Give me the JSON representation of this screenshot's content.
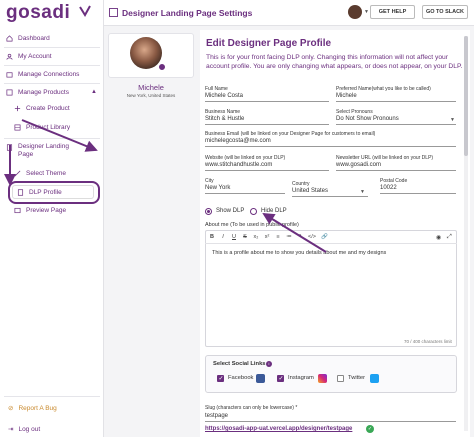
{
  "brand": {
    "logo_text": "gosadi",
    "accent": "#6b2f7f"
  },
  "sidebar": {
    "items": [
      {
        "label": "Dashboard",
        "icon": "home-icon"
      },
      {
        "label": "My Account",
        "icon": "user-icon"
      },
      {
        "label": "Manage Connections",
        "icon": "link-icon"
      },
      {
        "label": "Manage Products",
        "icon": "box-icon"
      },
      {
        "label": "Create Product",
        "icon": "plus-icon"
      },
      {
        "label": "Product Library",
        "icon": "library-icon"
      },
      {
        "label": "Designer Landing Page",
        "icon": "page-icon"
      },
      {
        "label": "Select Theme",
        "icon": "palette-icon"
      },
      {
        "label": "DLP Profile",
        "icon": "profile-icon"
      },
      {
        "label": "Preview Page",
        "icon": "eye-icon"
      }
    ],
    "report_bug": "Report A Bug",
    "logout": "Log out"
  },
  "header": {
    "title": "Designer Landing Page Settings",
    "get_help": "GET HELP",
    "go_to_slack": "GO TO SLACK"
  },
  "profile": {
    "name": "Michele",
    "location": "New York, United States"
  },
  "form": {
    "title": "Edit Designer Page Profile",
    "description": "This is for your front facing DLP only. Changing this information will not affect your account profile. You are only changing what appears, or does not appear, on your DLP.",
    "full_name_label": "Full Name",
    "full_name": "Michele Costa",
    "preferred_name_label": "Preferred Name(what you like to be called)",
    "preferred_name": "Michele",
    "business_name_label": "Business Name",
    "business_name": "Stitch & Hustle",
    "pronouns_label": "Select Pronouns",
    "pronouns": "Do Not Show Pronouns",
    "business_email_label": "Business Email (will be linked on your Designer Page for customers to email)",
    "business_email": "michelegcosta@me.com",
    "website_label": "Website (will be linked on your DLP)",
    "website": "www.stitchandhustle.com",
    "newsletter_label": "Newsletter URL (will be linked on your DLP)",
    "newsletter": "www.gosadi.com",
    "city_label": "City",
    "city": "New York",
    "country_label": "Country",
    "country": "United States",
    "postal_label": "Postal Code",
    "postal": "10022",
    "show_dlp": "Show DLP",
    "hide_dlp": "Hide DLP",
    "about_label": "About me (To be used in public profile)",
    "about_text": "This is a profile about me to show you details about me and my designs",
    "char_count": "70 / 400 characters limit",
    "toolbar": [
      "B",
      "I",
      "U",
      "S",
      "x₂",
      "x²",
      "≡",
      "≔",
      "❝",
      "</>",
      "🔗"
    ],
    "social_title": "Select Social Links",
    "facebook": "Facebook",
    "instagram": "Instagram",
    "twitter": "Twitter",
    "slug_label": "Slug (characters can only be lowercase) *",
    "slug": "testpage",
    "dlp_url": "https://gosadi-app-uat.vercel.app/designer/testpage"
  }
}
